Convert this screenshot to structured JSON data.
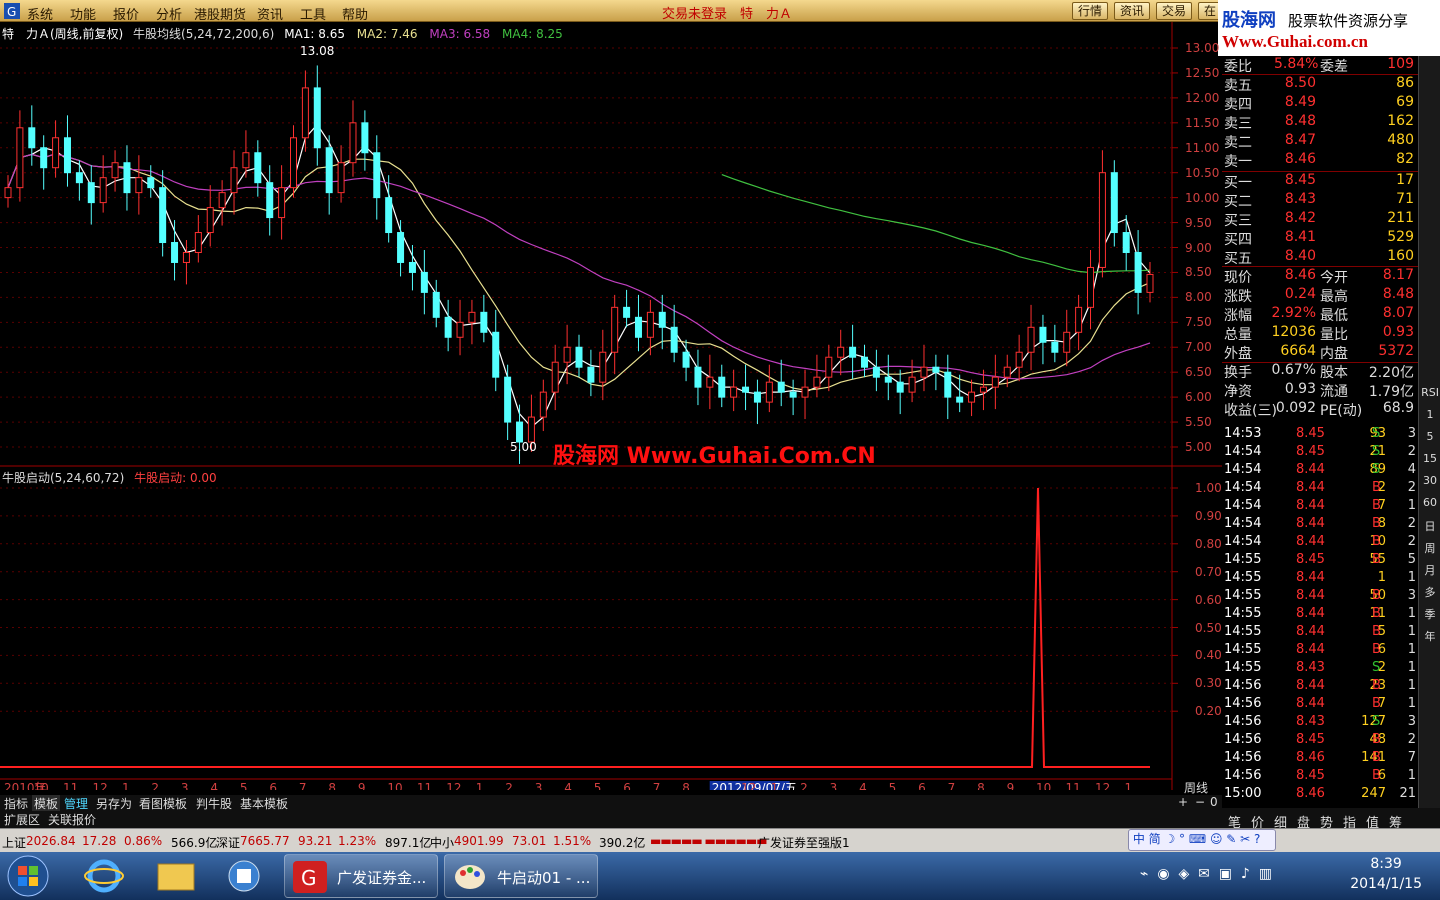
{
  "menu": [
    "系统",
    "功能",
    "报价",
    "分析",
    "港股期货",
    "资讯",
    "工具",
    "帮助"
  ],
  "window_title": "交易未登录　特　力Ａ",
  "top_buttons": [
    "行情",
    "资讯",
    "交易",
    "在"
  ],
  "banner": {
    "brand": "股海网",
    "tagline": "股票软件资源分享",
    "url": "Www.Guhai.com.cn"
  },
  "main_info": {
    "stock": "特　力Ａ(周线,前复权)",
    "indicator": "牛股均线(5,24,72,200,6)",
    "ma1": "MA1: 8.65",
    "ma2": "MA2: 7.46",
    "ma3": "MA3: 6.58",
    "ma4": "MA4: 8.25",
    "high_label": "13.08",
    "low_label": "5.00",
    "watermark": "股海网 Www.Guhai.Com.CN"
  },
  "sub_info": {
    "indicator": "牛股启动(5,24,60,72)",
    "value": "牛股启动: 0.00"
  },
  "price_axis": [
    "13.00",
    "12.50",
    "12.00",
    "11.50",
    "11.00",
    "10.50",
    "10.00",
    "9.50",
    "9.00",
    "8.50",
    "8.00",
    "7.50",
    "7.00",
    "6.50",
    "6.00",
    "5.50",
    "5.00"
  ],
  "sub_axis": [
    "1.00",
    "0.90",
    "0.80",
    "0.70",
    "0.60",
    "0.50",
    "0.40",
    "0.30",
    "0.20"
  ],
  "time_axis": [
    "2010年",
    "10",
    "11",
    "12",
    "1",
    "2",
    "3",
    "4",
    "5",
    "6",
    "7",
    "8",
    "9",
    "10",
    "11",
    "12",
    "1",
    "2",
    "3",
    "4",
    "5",
    "6",
    "7",
    "8",
    "2012/09/07/五",
    "12",
    "1",
    "2",
    "3",
    "4",
    "5",
    "6",
    "7",
    "8",
    "9",
    "10",
    "11",
    "12",
    "1"
  ],
  "period_label": "周线",
  "zoom_controls": [
    "+",
    "−",
    "0"
  ],
  "tabs": [
    "指标",
    "模板",
    "管理",
    "另存为",
    "看图模板",
    "判牛股",
    "基本模板"
  ],
  "tabs2": [
    "扩展区",
    "关联报价"
  ],
  "quote": {
    "ratio": {
      "l1": "委比",
      "v1": "5.84%",
      "l2": "委差",
      "v2": "109"
    },
    "sell": [
      {
        "label": "卖五",
        "price": "8.50",
        "vol": "86"
      },
      {
        "label": "卖四",
        "price": "8.49",
        "vol": "69"
      },
      {
        "label": "卖三",
        "price": "8.48",
        "vol": "162"
      },
      {
        "label": "卖二",
        "price": "8.47",
        "vol": "480"
      },
      {
        "label": "卖一",
        "price": "8.46",
        "vol": "82"
      }
    ],
    "buy": [
      {
        "label": "买一",
        "price": "8.45",
        "vol": "17"
      },
      {
        "label": "买二",
        "price": "8.43",
        "vol": "71"
      },
      {
        "label": "买三",
        "price": "8.42",
        "vol": "211"
      },
      {
        "label": "买四",
        "price": "8.41",
        "vol": "529"
      },
      {
        "label": "买五",
        "price": "8.40",
        "vol": "160"
      }
    ],
    "stats": [
      {
        "l1": "现价",
        "v1": "8.46",
        "l2": "今开",
        "v2": "8.17"
      },
      {
        "l1": "涨跌",
        "v1": "0.24",
        "l2": "最高",
        "v2": "8.48"
      },
      {
        "l1": "涨幅",
        "v1": "2.92%",
        "l2": "最低",
        "v2": "8.07"
      },
      {
        "l1": "总量",
        "v1": "12036",
        "l2": "量比",
        "v2": "0.93"
      },
      {
        "l1": "外盘",
        "v1": "6664",
        "l2": "内盘",
        "v2": "5372"
      },
      {
        "l1": "换手",
        "v1": "0.67%",
        "l2": "股本",
        "v2": "2.20亿"
      },
      {
        "l1": "净资",
        "v1": "0.93",
        "l2": "流通",
        "v2": "1.79亿"
      },
      {
        "l1": "收益(三)",
        "v1": "0.092",
        "l2": "PE(动)",
        "v2": "68.9"
      }
    ]
  },
  "trades": [
    {
      "time": "14:53",
      "price": "8.45",
      "vol": "93",
      "side": "S",
      "n": "3"
    },
    {
      "time": "14:54",
      "price": "8.45",
      "vol": "21",
      "side": "S",
      "n": "2"
    },
    {
      "time": "14:54",
      "price": "8.44",
      "vol": "89",
      "side": "S",
      "n": "4"
    },
    {
      "time": "14:54",
      "price": "8.44",
      "vol": "2",
      "side": "B",
      "n": "2"
    },
    {
      "time": "14:54",
      "price": "8.44",
      "vol": "7",
      "side": "B",
      "n": "1"
    },
    {
      "time": "14:54",
      "price": "8.44",
      "vol": "8",
      "side": "B",
      "n": "2"
    },
    {
      "time": "14:54",
      "price": "8.44",
      "vol": "10",
      "side": "B",
      "n": "2"
    },
    {
      "time": "14:55",
      "price": "8.45",
      "vol": "55",
      "side": "B",
      "n": "5"
    },
    {
      "time": "14:55",
      "price": "8.44",
      "vol": "1",
      "side": "",
      "n": "1"
    },
    {
      "time": "14:55",
      "price": "8.44",
      "vol": "50",
      "side": "B",
      "n": "3"
    },
    {
      "time": "14:55",
      "price": "8.44",
      "vol": "11",
      "side": "B",
      "n": "1"
    },
    {
      "time": "14:55",
      "price": "8.44",
      "vol": "5",
      "side": "B",
      "n": "1"
    },
    {
      "time": "14:55",
      "price": "8.44",
      "vol": "6",
      "side": "B",
      "n": "1"
    },
    {
      "time": "14:55",
      "price": "8.43",
      "vol": "2",
      "side": "S",
      "n": "1"
    },
    {
      "time": "14:56",
      "price": "8.44",
      "vol": "23",
      "side": "B",
      "n": "1"
    },
    {
      "time": "14:56",
      "price": "8.44",
      "vol": "7",
      "side": "B",
      "n": "1"
    },
    {
      "time": "14:56",
      "price": "8.43",
      "vol": "127",
      "side": "S",
      "n": "3"
    },
    {
      "time": "14:56",
      "price": "8.45",
      "vol": "48",
      "side": "B",
      "n": "2"
    },
    {
      "time": "14:56",
      "price": "8.46",
      "vol": "141",
      "side": "B",
      "n": "7"
    },
    {
      "time": "14:56",
      "price": "8.45",
      "vol": "6",
      "side": "B",
      "n": "1"
    },
    {
      "time": "15:00",
      "price": "8.46",
      "vol": "247",
      "side": "",
      "n": "21"
    }
  ],
  "sidebar": [
    "RSI",
    "1",
    "5",
    "15",
    "30",
    "60",
    "日",
    "周",
    "月",
    "多",
    "季",
    "年"
  ],
  "bottom_tabs": [
    "笔",
    "价",
    "细",
    "盘",
    "势",
    "指",
    "值",
    "筹"
  ],
  "status": {
    "sh_label": "上证",
    "sh_val": "2026.84",
    "sh_chg": "17.28",
    "sh_pct": "0.86%",
    "sh_amt": "566.9亿",
    "sz_label": "深证",
    "sz_val": "7665.77",
    "sz_chg": "93.21",
    "sz_pct": "1.23%",
    "sz_amt": "897.1亿",
    "zx_label": "中小",
    "zx_val": "4901.99",
    "zx_chg": "73.01",
    "zx_pct": "1.51%",
    "zx_amt": "390.2亿",
    "broker": "广发证券至强版1"
  },
  "taskbar": {
    "tasks": [
      "广发证券金...",
      "牛启动01 - ..."
    ],
    "time": "8:39",
    "date": "2014/1/15"
  },
  "colors": {
    "up": "#ff3030",
    "down": "#54ffff",
    "ma1": "#ffffff",
    "ma2": "#e8e090",
    "ma3": "#c040c0",
    "ma4": "#40c040",
    "grid": "#800000"
  },
  "chart_data": [
    {
      "type": "line",
      "title": "牛股均线(5,24,72,200,6)",
      "series": [
        {
          "name": "MA1",
          "values_note": "5-period",
          "last": 8.65
        },
        {
          "name": "MA2",
          "last": 7.46
        },
        {
          "name": "MA3",
          "last": 6.58
        },
        {
          "name": "MA4",
          "last": 8.25
        }
      ],
      "close": [
        10.2,
        11.4,
        11.0,
        10.6,
        11.2,
        10.5,
        10.3,
        9.9,
        10.4,
        10.7,
        10.1,
        10.4,
        10.2,
        9.1,
        8.7,
        8.9,
        9.3,
        9.8,
        10.1,
        10.6,
        10.9,
        10.3,
        9.6,
        10.2,
        11.2,
        12.2,
        11.0,
        10.1,
        10.7,
        11.5,
        10.9,
        10.0,
        9.3,
        8.7,
        8.5,
        8.1,
        7.6,
        7.2,
        7.5,
        7.7,
        7.3,
        6.4,
        5.5,
        5.1,
        5.6,
        6.1,
        6.7,
        7.0,
        6.6,
        6.3,
        6.9,
        7.8,
        7.6,
        7.2,
        7.7,
        7.4,
        6.9,
        6.6,
        6.2,
        6.4,
        6.0,
        6.2,
        6.1,
        5.9,
        6.3,
        6.1,
        6.0,
        6.2,
        6.4,
        6.8,
        7.0,
        6.8,
        6.6,
        6.4,
        6.3,
        6.1,
        6.4,
        6.6,
        6.5,
        6.0,
        5.9,
        6.1,
        6.2,
        6.4,
        6.6,
        6.9,
        7.4,
        7.1,
        6.9,
        7.3,
        7.8,
        8.6,
        10.5,
        9.3,
        8.9,
        8.1,
        8.46
      ],
      "ylim": [
        4.8,
        13.2
      ]
    },
    {
      "type": "line",
      "title": "牛股启动(5,24,60,72)",
      "values_note": "flat at 0, single spike to 1.00 near Sep-2013",
      "ylim": [
        0,
        1.05
      ]
    }
  ]
}
